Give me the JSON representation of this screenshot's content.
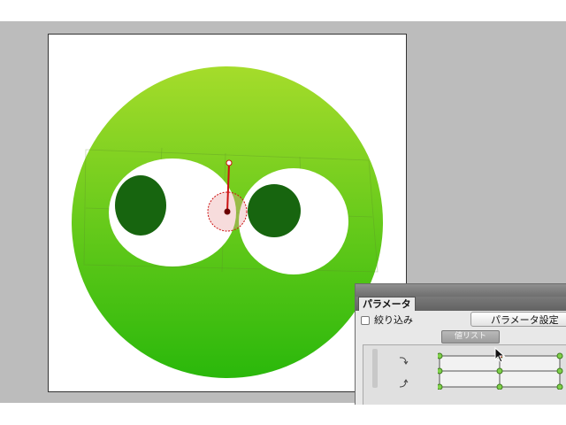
{
  "panel": {
    "tab_label": "パラメータ",
    "filter_label": "絞り込み",
    "filter_checked": false,
    "settings_button_label": "パラメータ設定",
    "value_list_tab_label": "値リスト"
  },
  "colors": {
    "workspace": "#bcbcbc",
    "face_top": "#a5dc2b",
    "face_bottom": "#2ab80b",
    "pupil": "#17650f",
    "guide_red": "#cc1111",
    "keypoint_green": "#7fd14a"
  },
  "icons": {
    "row_1": "rotate-clockwise-icon",
    "row_2": "rotate-up-arrow-icon",
    "cursor": "mouse-pointer-icon"
  }
}
